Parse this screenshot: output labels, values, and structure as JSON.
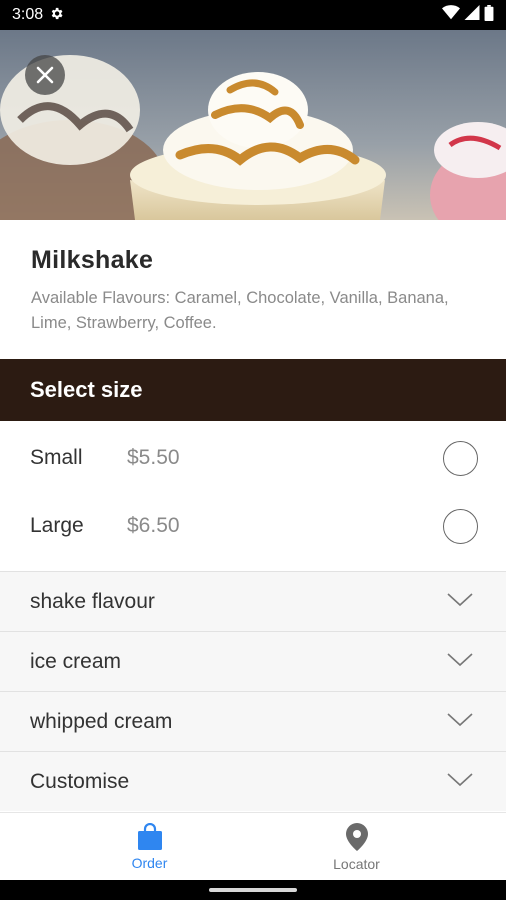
{
  "status_bar": {
    "time": "3:08",
    "icons": [
      "gear-icon",
      "wifi-icon",
      "signal-icon",
      "battery-icon"
    ]
  },
  "hero": {
    "close_icon": "close-icon"
  },
  "product": {
    "title": "Milkshake",
    "description": "Available Flavours: Caramel, Chocolate, Vanilla, Banana, Lime, Strawberry, Coffee."
  },
  "size_section": {
    "header": "Select size",
    "options": [
      {
        "name": "Small",
        "price": "$5.50",
        "selected": false
      },
      {
        "name": "Large",
        "price": "$6.50",
        "selected": false
      }
    ]
  },
  "option_groups": [
    {
      "label": "shake flavour"
    },
    {
      "label": "ice cream"
    },
    {
      "label": "whipped cream"
    },
    {
      "label": "Customise"
    }
  ],
  "bottom_nav": {
    "items": [
      {
        "label": "Order",
        "icon": "shopping-bag-icon",
        "active": true
      },
      {
        "label": "Locator",
        "icon": "location-pin-icon",
        "active": false
      }
    ]
  },
  "colors": {
    "header_bg": "#2c1b12",
    "accent": "#2f86f0"
  }
}
